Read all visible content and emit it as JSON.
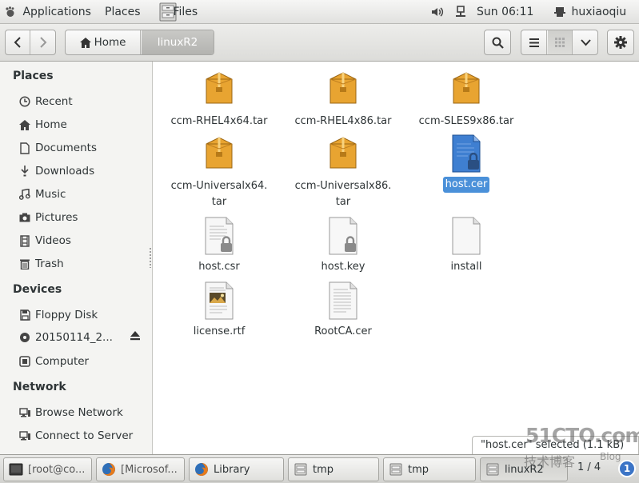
{
  "topbar": {
    "applications": "Applications",
    "places": "Places",
    "app_name": "Files",
    "clock": "Sun 06:11",
    "user": "huxiaoqiu"
  },
  "headerbar": {
    "breadcrumb_home": "Home",
    "breadcrumb_current": "linuxR2"
  },
  "sidebar": {
    "places_heading": "Places",
    "places": [
      {
        "label": "Recent",
        "icon": "clock-icon"
      },
      {
        "label": "Home",
        "icon": "home-icon"
      },
      {
        "label": "Documents",
        "icon": "document-icon"
      },
      {
        "label": "Downloads",
        "icon": "download-icon"
      },
      {
        "label": "Music",
        "icon": "music-icon"
      },
      {
        "label": "Pictures",
        "icon": "camera-icon"
      },
      {
        "label": "Videos",
        "icon": "film-icon"
      },
      {
        "label": "Trash",
        "icon": "trash-icon"
      }
    ],
    "devices_heading": "Devices",
    "devices": [
      {
        "label": "Floppy Disk",
        "icon": "floppy-icon"
      },
      {
        "label": "20150114_2...",
        "icon": "disc-icon"
      },
      {
        "label": "Computer",
        "icon": "computer-icon"
      }
    ],
    "network_heading": "Network",
    "network": [
      {
        "label": "Browse Network",
        "icon": "network-icon"
      },
      {
        "label": "Connect to Server",
        "icon": "server-icon"
      }
    ]
  },
  "files": [
    {
      "name": "ccm-RHEL4x64.tar",
      "type": "archive"
    },
    {
      "name": "ccm-RHEL4x86.tar",
      "type": "archive"
    },
    {
      "name": "ccm-SLES9x86.tar",
      "type": "archive"
    },
    {
      "name": "ccm-Universalx64.\ntar",
      "line1": "ccm-Universalx64.",
      "line2": "tar",
      "type": "archive"
    },
    {
      "name": "ccm-Universalx86.\ntar",
      "line1": "ccm-Universalx86.",
      "line2": "tar",
      "type": "archive"
    },
    {
      "name": "host.cer",
      "type": "certificate",
      "selected": true
    },
    {
      "name": "host.csr",
      "type": "locked-text"
    },
    {
      "name": "host.key",
      "type": "locked-text"
    },
    {
      "name": "install",
      "type": "blank"
    },
    {
      "name": "license.rtf",
      "type": "rtf"
    },
    {
      "name": "RootCA.cer",
      "type": "text"
    }
  ],
  "statusbar": {
    "text": "\"host.cer\" selected (1.1 kB)"
  },
  "taskbar": {
    "items": [
      {
        "label": "[root@co...",
        "icon": "terminal-icon"
      },
      {
        "label": "[Microsof...",
        "icon": "firefox-icon"
      },
      {
        "label": "Library",
        "icon": "firefox-icon"
      },
      {
        "label": "tmp",
        "icon": "folder-window-icon"
      },
      {
        "label": "tmp",
        "icon": "folder-window-icon"
      },
      {
        "label": "linuxR2",
        "icon": "folder-window-icon"
      }
    ],
    "pager": "1 / 4",
    "pager_badge": "1"
  },
  "watermark": {
    "line1": "51CTO.com",
    "line2": "技术博客",
    "line3": "Blog"
  },
  "colors": {
    "selection": "#4a90d9",
    "archive": "#e8a431",
    "sidebar_bg": "#f4f4f2"
  }
}
